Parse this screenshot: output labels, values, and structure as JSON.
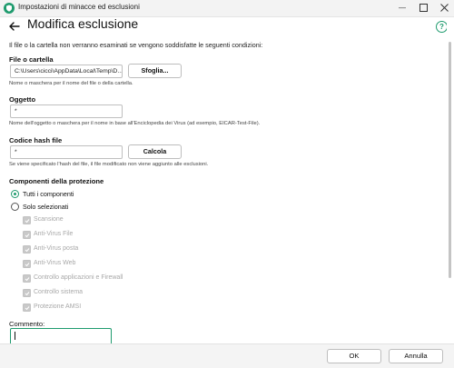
{
  "window": {
    "title": "Impostazioni di minacce ed esclusioni",
    "minimize_symbol": "—",
    "accent_color": "#1f9b6e"
  },
  "header": {
    "title": "Modifica esclusione",
    "back_icon": "arrow-left-icon",
    "help_icon": "question-circle-icon",
    "help_symbol": "?"
  },
  "intro": "Il file o la cartella non verranno esaminati se vengono soddisfatte le seguenti condizioni:",
  "file_section": {
    "label": "File o cartella",
    "value": "C:\\Users\\cicci\\AppData\\Local\\Temp\\D...",
    "browse_label": "Sfoglia...",
    "hint": "Nome o maschera per il nome del file o della cartella."
  },
  "object_section": {
    "label": "Oggetto",
    "value": "*",
    "hint": "Nome dell'oggetto o maschera per il nome in base all'Enciclopedia dei Virus (ad esempio, EICAR-Test-File)."
  },
  "hash_section": {
    "label": "Codice hash file",
    "value": "*",
    "calc_label": "Calcola",
    "hint": "Se viene specificato l'hash del file, il file modificato non viene aggiunto alle esclusioni."
  },
  "components": {
    "label": "Componenti della protezione",
    "radios": [
      {
        "label": "Tutti i componenti",
        "checked": true
      },
      {
        "label": "Solo selezionati",
        "checked": false
      }
    ],
    "checkboxes": [
      {
        "label": "Scansione"
      },
      {
        "label": "Anti-Virus File"
      },
      {
        "label": "Anti-Virus posta"
      },
      {
        "label": "Anti-Virus Web"
      },
      {
        "label": "Controllo applicazioni e Firewall"
      },
      {
        "label": "Controllo sistema"
      },
      {
        "label": "Protezione AMSI"
      }
    ]
  },
  "comment": {
    "label": "Commento:",
    "value": ""
  },
  "footer": {
    "ok_label": "OK",
    "cancel_label": "Annulla"
  }
}
